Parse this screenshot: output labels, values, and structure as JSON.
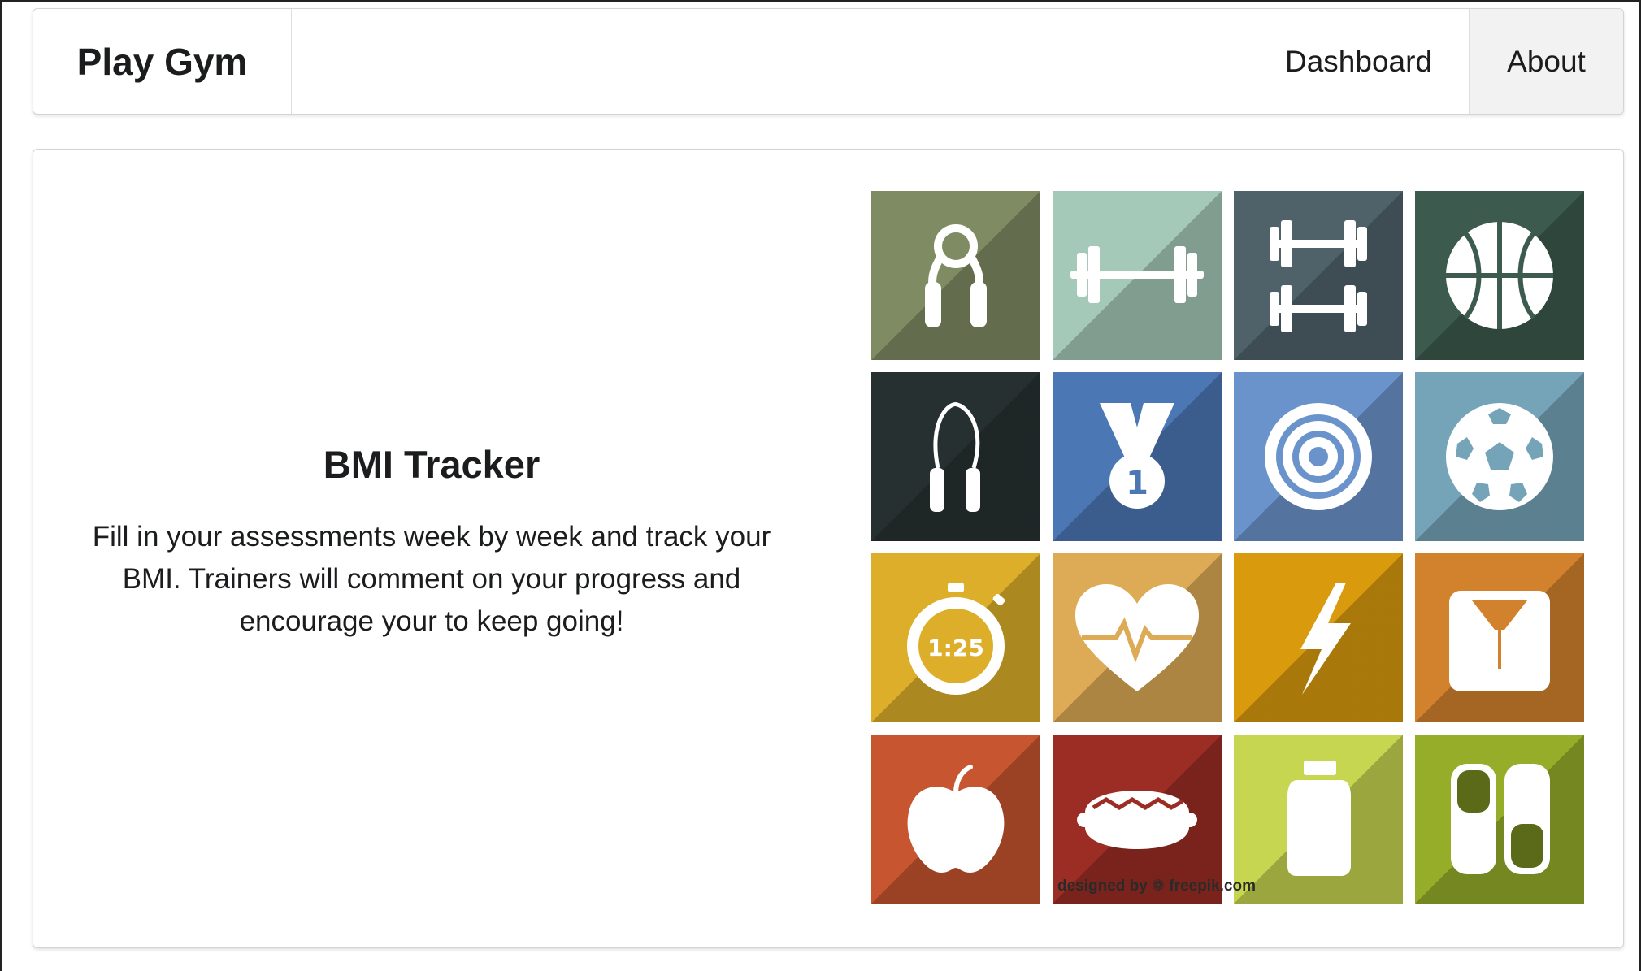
{
  "navbar": {
    "brand": "Play Gym",
    "items": [
      {
        "label": "Dashboard"
      },
      {
        "label": "About",
        "active": true
      }
    ]
  },
  "intro": {
    "title": "BMI Tracker",
    "text": "Fill in your assessments week by week and track your BMI. Trainers will comment on your progress and encourage your to keep going!"
  },
  "tiles": [
    {
      "icon": "hand-grip-icon",
      "color": "#7f8b63"
    },
    {
      "icon": "barbell-icon",
      "color": "#a4c9b8"
    },
    {
      "icon": "dumbbells-icon",
      "color": "#4f626a"
    },
    {
      "icon": "basketball-icon",
      "color": "#3c5a4d"
    },
    {
      "icon": "jump-rope-icon",
      "color": "#263031"
    },
    {
      "icon": "medal-icon",
      "color": "#4c77b5",
      "text": "1"
    },
    {
      "icon": "target-icon",
      "color": "#6b93cb"
    },
    {
      "icon": "soccer-ball-icon",
      "color": "#75a4b9"
    },
    {
      "icon": "stopwatch-icon",
      "color": "#dcae29",
      "text": "1:25"
    },
    {
      "icon": "heart-pulse-icon",
      "color": "#ddaa55"
    },
    {
      "icon": "lightning-icon",
      "color": "#d99a0e"
    },
    {
      "icon": "scale-icon",
      "color": "#d2822c"
    },
    {
      "icon": "apple-icon",
      "color": "#c7552f"
    },
    {
      "icon": "hotdog-icon",
      "color": "#9b2d24"
    },
    {
      "icon": "water-bottle-icon",
      "color": "#c7d650"
    },
    {
      "icon": "pills-icon",
      "color": "#96ad2a"
    }
  ],
  "credit": {
    "prefix": "designed by",
    "brand": "freepik.com"
  }
}
